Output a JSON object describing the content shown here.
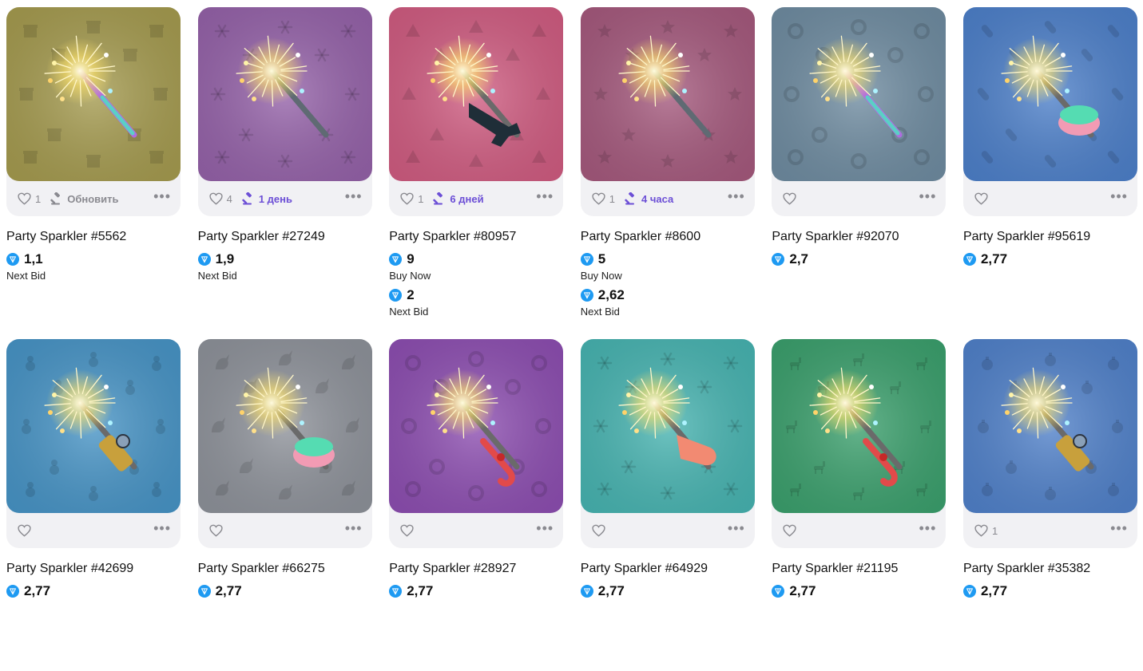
{
  "colors": {
    "ton_blue": "#1e9af2",
    "auction_purple": "#6c4fd6",
    "meta_grey": "#8a8a90"
  },
  "items": [
    {
      "title": "Party Sparkler #5562",
      "likes": "1",
      "timer": "Обновить",
      "timer_style": "neutral",
      "bg": "#a49a4e",
      "pattern": "gift",
      "accessory": "rainbow stick",
      "prices": [
        {
          "value": "1,1",
          "label": "Next Bid"
        }
      ]
    },
    {
      "title": "Party Sparkler #27249",
      "likes": "4",
      "timer": "1 день",
      "timer_style": "active",
      "bg": "#9461a8",
      "pattern": "snowflake",
      "accessory": "silver stick",
      "prices": [
        {
          "value": "1,9",
          "label": "Next Bid"
        }
      ]
    },
    {
      "title": "Party Sparkler #80957",
      "likes": "1",
      "timer": "6 дней",
      "timer_style": "active",
      "bg": "#cf5b80",
      "pattern": "pizza",
      "accessory": "gun",
      "prices": [
        {
          "value": "9",
          "label": "Buy Now"
        },
        {
          "value": "2",
          "label": "Next Bid"
        }
      ]
    },
    {
      "title": "Party Sparkler #8600",
      "likes": "1",
      "timer": "4 часа",
      "timer_style": "active",
      "bg": "#a4587c",
      "pattern": "star",
      "accessory": "silver stick",
      "prices": [
        {
          "value": "5",
          "label": "Buy Now"
        },
        {
          "value": "2,62",
          "label": "Next Bid"
        }
      ]
    },
    {
      "title": "Party Sparkler #92070",
      "likes": "",
      "timer": "",
      "timer_style": "none",
      "bg": "#6e8ba0",
      "pattern": "wreath",
      "accessory": "rainbow stick",
      "prices": [
        {
          "value": "2,7",
          "label": ""
        }
      ]
    },
    {
      "title": "Party Sparkler #95619",
      "likes": "",
      "timer": "",
      "timer_style": "none",
      "bg": "#4c7fc9",
      "pattern": "pill",
      "accessory": "cake",
      "prices": [
        {
          "value": "2,77",
          "label": ""
        }
      ]
    },
    {
      "title": "Party Sparkler #42699",
      "likes": "",
      "timer": "",
      "timer_style": "none",
      "bg": "#4693c5",
      "pattern": "snowman",
      "accessory": "battery",
      "prices": [
        {
          "value": "2,77",
          "label": ""
        }
      ]
    },
    {
      "title": "Party Sparkler #66275",
      "likes": "",
      "timer": "",
      "timer_style": "none",
      "bg": "#8d9199",
      "pattern": "unicorn",
      "accessory": "cake",
      "prices": [
        {
          "value": "2,77",
          "label": ""
        }
      ]
    },
    {
      "title": "Party Sparkler #28927",
      "likes": "",
      "timer": "",
      "timer_style": "none",
      "bg": "#8c4db0",
      "pattern": "wreath",
      "accessory": "candy cane",
      "prices": [
        {
          "value": "2,77",
          "label": ""
        }
      ]
    },
    {
      "title": "Party Sparkler #64929",
      "likes": "",
      "timer": "",
      "timer_style": "none",
      "bg": "#46b3b0",
      "pattern": "snowflake",
      "accessory": "spider glove",
      "prices": [
        {
          "value": "2,77",
          "label": ""
        }
      ]
    },
    {
      "title": "Party Sparkler #21195",
      "likes": "",
      "timer": "",
      "timer_style": "none",
      "bg": "#3a9f6c",
      "pattern": "deer",
      "accessory": "candy cane",
      "prices": [
        {
          "value": "2,77",
          "label": ""
        }
      ]
    },
    {
      "title": "Party Sparkler #35382",
      "likes": "1",
      "timer": "",
      "timer_style": "none",
      "bg": "#4f80c9",
      "pattern": "ornament",
      "accessory": "battery",
      "prices": [
        {
          "value": "2,77",
          "label": ""
        }
      ]
    }
  ]
}
